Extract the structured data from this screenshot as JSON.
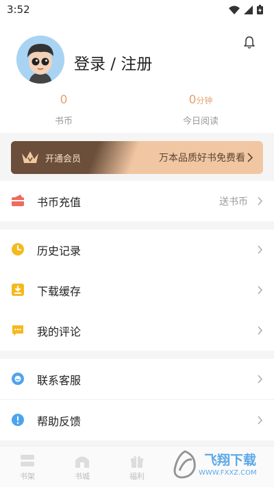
{
  "status": {
    "time": "3:52"
  },
  "profile": {
    "login_label": "登录 / 注册"
  },
  "stats": [
    {
      "value": "0",
      "unit": "",
      "label": "书币"
    },
    {
      "value": "0",
      "unit": "分钟",
      "label": "今日阅读"
    }
  ],
  "vip": {
    "open_label": "开通会员",
    "promo_label": "万本品质好书免费看"
  },
  "recharge": {
    "label": "书币充值",
    "value": "送书币"
  },
  "menu_group1": [
    {
      "label": "历史记录",
      "icon": "clock-icon"
    },
    {
      "label": "下载缓存",
      "icon": "download-icon"
    },
    {
      "label": "我的评论",
      "icon": "comment-icon"
    }
  ],
  "menu_group2": [
    {
      "label": "联系客服",
      "icon": "customer-service-icon"
    },
    {
      "label": "帮助反馈",
      "icon": "help-feedback-icon"
    }
  ],
  "tabs": [
    {
      "label": "书架"
    },
    {
      "label": "书城"
    },
    {
      "label": "福利"
    },
    {
      "label": ""
    },
    {
      "label": ""
    }
  ],
  "watermark": {
    "title": "飞翔下载",
    "url": "WWW.FXXZ.COM"
  },
  "colors": {
    "accent": "#e8a172",
    "vip_dark": "#6b4f3a",
    "vip_light": "#f1c6a2"
  }
}
